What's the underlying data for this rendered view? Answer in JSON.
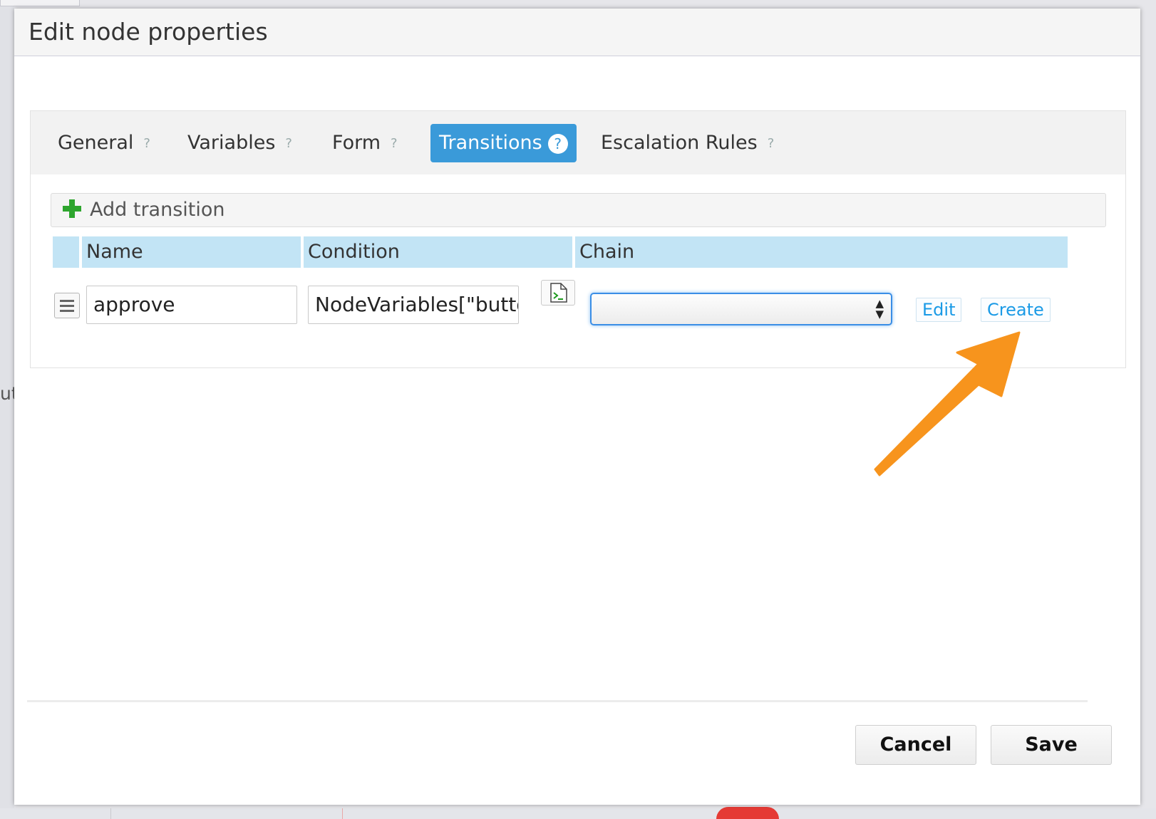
{
  "background": {
    "cut_text": "uto"
  },
  "dialog": {
    "title": "Edit node properties"
  },
  "tabs": [
    {
      "label": "General",
      "help": "?"
    },
    {
      "label": "Variables",
      "help": "?"
    },
    {
      "label": "Form",
      "help": "?"
    },
    {
      "label": "Transitions",
      "help": "?",
      "active": true
    },
    {
      "label": "Escalation Rules",
      "help": "?"
    }
  ],
  "transitions": {
    "add_label": "Add transition",
    "columns": [
      "Name",
      "Condition",
      "Chain"
    ],
    "rows": [
      {
        "name": "approve",
        "condition": "NodeVariables[\"butto",
        "chain": ""
      }
    ],
    "edit_label": "Edit",
    "create_label": "Create"
  },
  "footer": {
    "cancel_label": "Cancel",
    "save_label": "Save"
  },
  "colors": {
    "active_tab": "#3a9ad9",
    "header_row": "#c2e4f5",
    "annotation_arrow": "#f7941d",
    "link": "#1a9ae6"
  },
  "icons": [
    "plus-icon",
    "help-icon",
    "drag-handle-icon",
    "script-editor-icon",
    "select-arrows-icon",
    "arrow-annotation"
  ]
}
